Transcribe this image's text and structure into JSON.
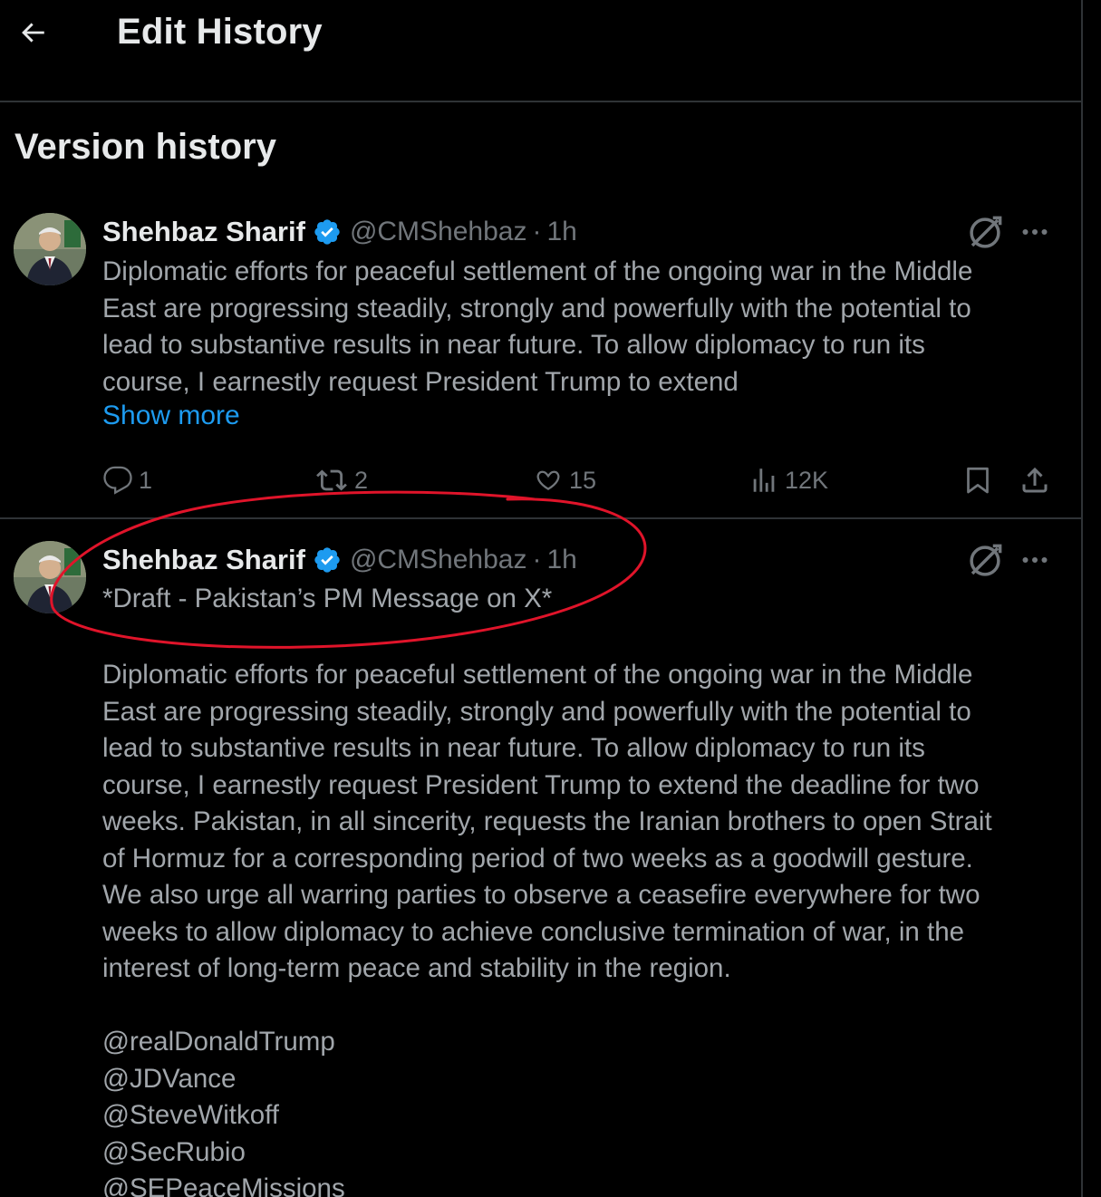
{
  "header": {
    "title": "Edit History"
  },
  "section": {
    "title": "Version history"
  },
  "versions": [
    {
      "author": "Shehbaz Sharif",
      "handle": "@CMShehbaz",
      "separator": "·",
      "time": "1h",
      "text": "Diplomatic efforts for peaceful settlement of the ongoing war in the Middle\nEast are progressing steadily, strongly and powerfully with the potential to\nlead to substantive results in near future. To allow diplomacy to run its\ncourse, I earnestly request President Trump to extend",
      "show_more": "Show more",
      "metrics": {
        "replies": "1",
        "reposts": "2",
        "likes": "15",
        "views": "12K"
      }
    },
    {
      "author": "Shehbaz Sharif",
      "handle": "@CMShehbaz",
      "separator": "·",
      "time": "1h",
      "draft_line": "*Draft - Pakistan’s PM Message on X*",
      "text": "Diplomatic efforts for peaceful settlement of the ongoing war in the Middle\nEast are progressing steadily, strongly and powerfully with the potential to\nlead to substantive results in near future. To allow diplomacy to run its\ncourse, I earnestly request President Trump to extend the deadline for two\nweeks. Pakistan, in all sincerity, requests the Iranian brothers to open Strait\nof Hormuz for a corresponding period of two weeks as a goodwill gesture.\nWe also urge all warring parties to observe a ceasefire everywhere for two\nweeks to allow diplomacy to achieve conclusive termination of war, in the\ninterest of long-term peace and stability in the region.",
      "mentions": [
        "@realDonaldTrump",
        "@JDVance",
        "@SteveWitkoff",
        "@SecRubio",
        "@SEPeaceMissions"
      ]
    }
  ],
  "icons": {
    "back": "arrow-left-icon",
    "verified": "verified-badge-icon",
    "edit": "edit-history-icon",
    "more": "more-horizontal-icon",
    "reply": "reply-icon",
    "repost": "repost-icon",
    "like": "heart-icon",
    "views": "views-icon",
    "bookmark": "bookmark-icon",
    "share": "share-icon"
  },
  "colors": {
    "background": "#000000",
    "primary_text": "#e7e9ea",
    "secondary_text": "#71767b",
    "link": "#1d9bf0",
    "verified": "#1d9bf0",
    "annotation": "#e0142a"
  }
}
